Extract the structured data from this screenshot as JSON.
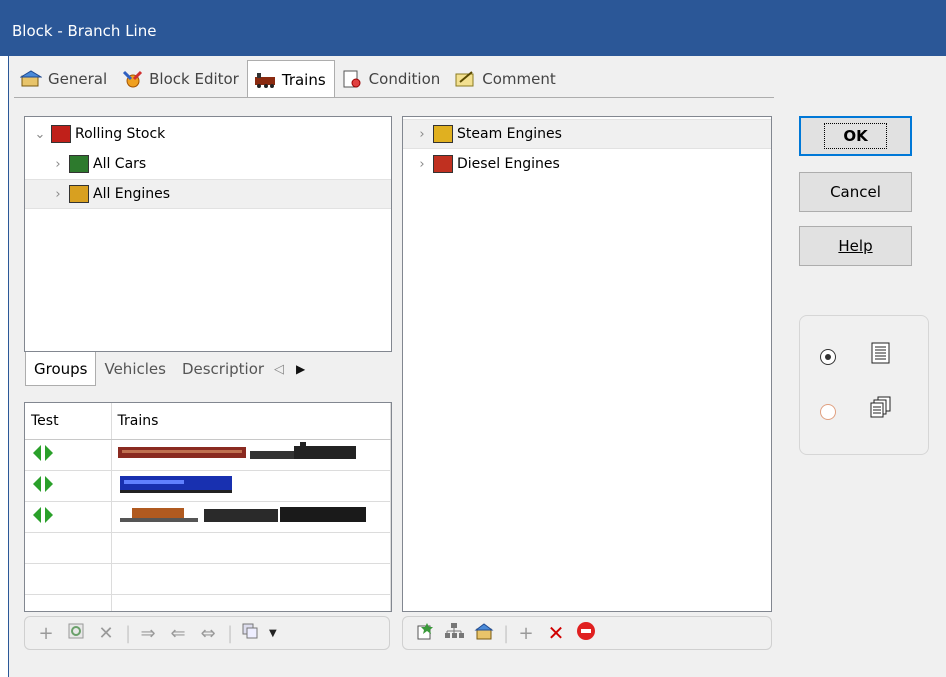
{
  "window": {
    "title": "Block - Branch Line"
  },
  "tabs": [
    {
      "label": "General",
      "icon": "general-icon"
    },
    {
      "label": "Block Editor",
      "icon": "block-editor-icon"
    },
    {
      "label": "Trains",
      "icon": "trains-icon",
      "active": true
    },
    {
      "label": "Condition",
      "icon": "condition-icon"
    },
    {
      "label": "Comment",
      "icon": "comment-icon"
    }
  ],
  "left_tree": {
    "root": "Rolling Stock",
    "items": [
      "All Cars",
      "All Engines"
    ],
    "selected": "All Engines"
  },
  "subtabs": [
    "Groups",
    "Vehicles",
    "Descriptior"
  ],
  "grid": {
    "headers": [
      "Test",
      "Trains"
    ],
    "rows": [
      {
        "train": "passenger-car-steam-engine"
      },
      {
        "train": "diesel-locomotive"
      },
      {
        "train": "flatcar-steam-engine"
      }
    ]
  },
  "right_tree": {
    "items": [
      "Steam Engines",
      "Diesel Engines"
    ],
    "selected": "Steam Engines"
  },
  "buttons": {
    "ok": "OK",
    "cancel": "Cancel",
    "help": "Help"
  },
  "view_options": {
    "selected": "list-view"
  },
  "colors": {
    "titlebar": "#2b5797",
    "accent": "#0078d7",
    "delete": "#d00000"
  }
}
